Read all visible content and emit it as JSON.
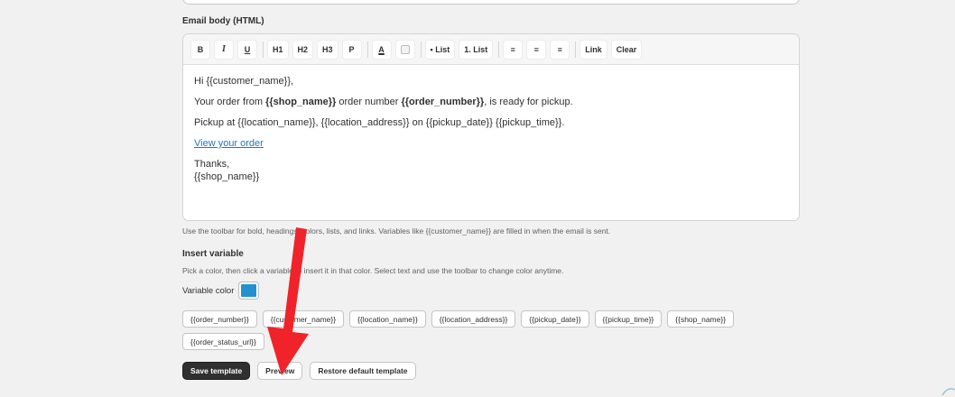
{
  "email_body": {
    "label": "Email body (HTML)",
    "toolbar": {
      "bold": "B",
      "italic": "I",
      "underline": "U",
      "h1": "H1",
      "h2": "H2",
      "h3": "H3",
      "paragraph": "P",
      "text_color": "A",
      "bullet_list": "• List",
      "numbered_list": "1. List",
      "align_left": "≡",
      "align_center": "≡",
      "align_right": "≡",
      "link": "Link",
      "clear": "Clear"
    },
    "content": {
      "greeting": "Hi {{customer_name}},",
      "line2_prefix": "Your order from ",
      "line2_shop": "{{shop_name}}",
      "line2_mid": " order number ",
      "line2_order": "{{order_number}}",
      "line2_suffix": ", is ready for pickup.",
      "line3": "Pickup at {{location_name}}, {{location_address}} on {{pickup_date}} {{pickup_time}}.",
      "link_text": "View your order",
      "thanks": "Thanks,",
      "signature": "{{shop_name}}"
    },
    "helper": "Use the toolbar for bold, headings, colors, lists, and links. Variables like {{customer_name}} are filled in when the email is sent."
  },
  "insert_variable": {
    "label": "Insert variable",
    "helper": "Pick a color, then click a variable to insert it in that color. Select text and use the toolbar to change color anytime.",
    "color_label": "Variable color",
    "color": "#2291d0",
    "variables": [
      "{{order_number}}",
      "{{customer_name}}",
      "{{location_name}}",
      "{{location_address}}",
      "{{pickup_date}}",
      "{{pickup_time}}",
      "{{shop_name}}",
      "{{order_status_url}}"
    ]
  },
  "actions": {
    "save": "Save template",
    "preview": "Preview",
    "restore": "Restore default template"
  },
  "annotation": {
    "arrow_color": "#f0232a"
  }
}
